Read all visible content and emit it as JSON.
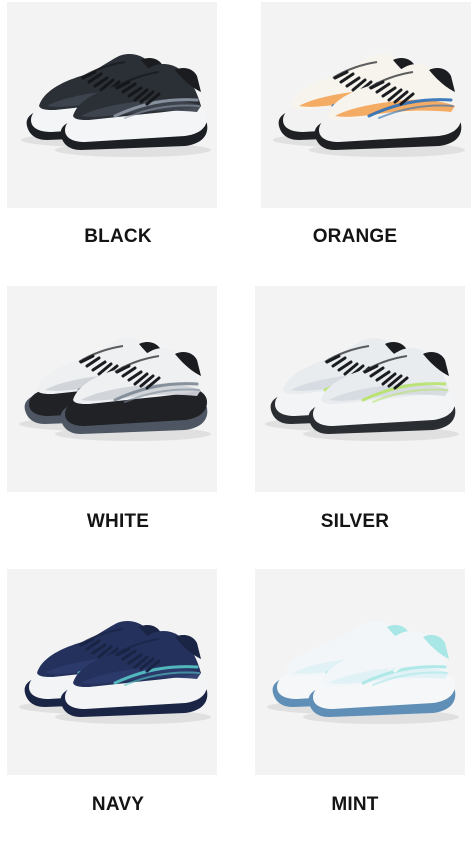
{
  "products": [
    {
      "label": "BLACK",
      "colors": {
        "upper": "#2b2f36",
        "mesh": "#3f4650",
        "midsole": "#f4f5f7",
        "outsole": "#1c1f24",
        "accent": "#8e98a6",
        "laces": "#15171a",
        "collar": "#1a1c20"
      }
    },
    {
      "label": "ORANGE",
      "colors": {
        "upper": "#f7f4ee",
        "mesh": "#f3a65c",
        "midsole": "#f2f2f2",
        "outsole": "#1e2024",
        "accent": "#2b6fb8",
        "laces": "#1b1d21",
        "collar": "#1b1d21"
      }
    },
    {
      "label": "WHITE",
      "colors": {
        "upper": "#eef0f2",
        "mesh": "#cfd3d8",
        "midsole": "#202226",
        "outsole": "#4d5662",
        "accent": "#7c8794",
        "laces": "#1a1c20",
        "collar": "#1a1c20"
      }
    },
    {
      "label": "SILVER",
      "colors": {
        "upper": "#e9ecef",
        "mesh": "#d6dbe0",
        "midsole": "#f3f4f5",
        "outsole": "#2a2d31",
        "accent": "#b7e36a",
        "laces": "#1a1c20",
        "collar": "#1a1c20"
      }
    },
    {
      "label": "NAVY",
      "colors": {
        "upper": "#23315c",
        "mesh": "#2c3b6b",
        "midsole": "#f3f4f6",
        "outsole": "#1a2445",
        "accent": "#56c7c6",
        "laces": "#1a2444",
        "collar": "#1a2444"
      }
    },
    {
      "label": "MINT",
      "colors": {
        "upper": "#f2f6f9",
        "mesh": "#dff1f6",
        "midsole": "#f6f7f8",
        "outsole": "#5f8fb6",
        "accent": "#a9e7e6",
        "laces": "#f2f6f9",
        "collar": "#a9e7e6"
      }
    }
  ]
}
